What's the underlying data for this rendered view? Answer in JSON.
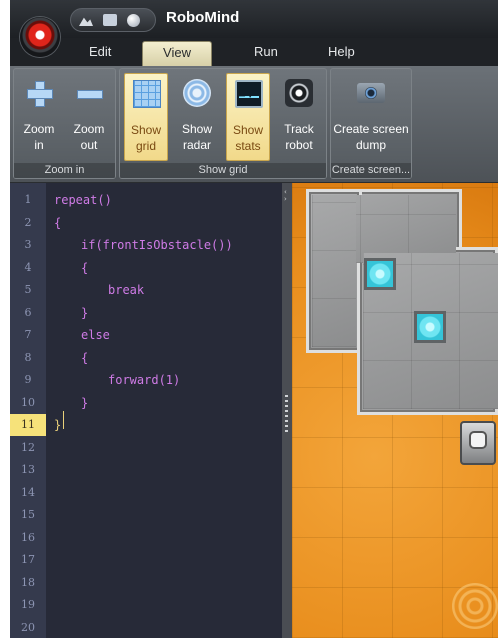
{
  "app": {
    "title": "RoboMind"
  },
  "tabs": [
    {
      "label": "Edit"
    },
    {
      "label": "View"
    },
    {
      "label": "Run"
    },
    {
      "label": "Help"
    }
  ],
  "ribbon": {
    "zoom": {
      "caption": "Zoom in",
      "buttons": [
        {
          "line1": "Zoom",
          "line2": "in",
          "icon": "zoom-in-plus-icon"
        },
        {
          "line1": "Zoom",
          "line2": "out",
          "icon": "zoom-out-minus-icon"
        }
      ]
    },
    "show": {
      "caption": "Show grid",
      "buttons": [
        {
          "line1": "Show",
          "line2": "grid",
          "icon": "grid-icon",
          "active": true
        },
        {
          "line1": "Show",
          "line2": "radar",
          "icon": "radar-icon",
          "active": false
        },
        {
          "line1": "Show",
          "line2": "stats",
          "icon": "stats-monitor-icon",
          "active": true
        },
        {
          "line1": "Track",
          "line2": "robot",
          "icon": "track-robot-icon",
          "active": false
        }
      ]
    },
    "screen": {
      "caption": "Create screen...",
      "buttons": [
        {
          "line1": "Create screen",
          "line2": "dump",
          "icon": "camera-icon"
        }
      ]
    }
  },
  "editor": {
    "current_line": 11,
    "line_numbers": [
      "1",
      "2",
      "3",
      "4",
      "5",
      "6",
      "7",
      "8",
      "9",
      "10",
      "11",
      "12",
      "13",
      "14",
      "15",
      "16",
      "17",
      "18",
      "19",
      "20"
    ],
    "lines": [
      {
        "text": "repeat()",
        "indent": 0
      },
      {
        "text": "{",
        "indent": 0
      },
      {
        "text": "if(frontIsObstacle())",
        "indent": 1
      },
      {
        "text": "{",
        "indent": 1
      },
      {
        "text": "break",
        "indent": 2
      },
      {
        "text": "}",
        "indent": 1
      },
      {
        "text": "else",
        "indent": 1
      },
      {
        "text": "{",
        "indent": 1
      },
      {
        "text": "forward(1)",
        "indent": 2
      },
      {
        "text": "}",
        "indent": 1
      },
      {
        "text": "}",
        "indent": 0
      }
    ]
  },
  "world": {
    "floor": "sand",
    "accent_colors": {
      "floor": "#e88d1c",
      "beacon": "#6fe5f2",
      "wall": "#9a9b9c"
    }
  },
  "colors": {
    "active_button": "#f1d98a",
    "editor_bg": "#272a38",
    "code_text": "#cf7be6",
    "current_line": "#f6e27a"
  }
}
